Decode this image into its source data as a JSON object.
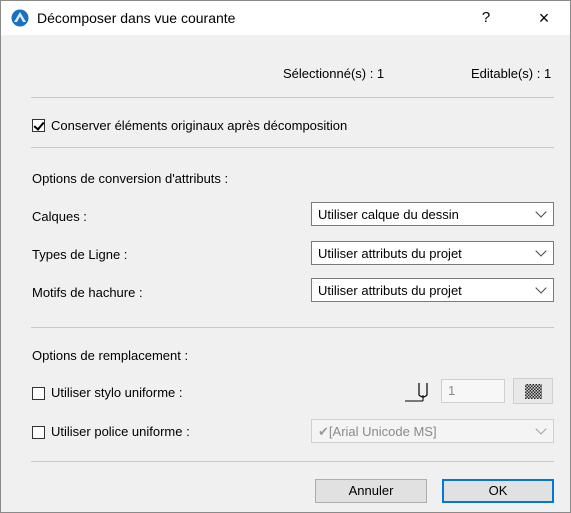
{
  "window": {
    "title": "Décomposer dans vue courante",
    "help": "?",
    "close": "×"
  },
  "status": {
    "selected": "Sélectionné(s) : 1",
    "editable": "Editable(s) : 1"
  },
  "keep_originals": {
    "label": "Conserver éléments originaux après décomposition",
    "checked": true
  },
  "conversion": {
    "heading": "Options de conversion d'attributs :",
    "rows": [
      {
        "label": "Calques :",
        "value": "Utiliser calque du dessin"
      },
      {
        "label": "Types de Ligne :",
        "value": "Utiliser attributs du projet"
      },
      {
        "label": "Motifs de hachure :",
        "value": "Utiliser attributs du projet"
      }
    ]
  },
  "replacement": {
    "heading": "Options de remplacement :",
    "pen": {
      "label": "Utiliser stylo uniforme :",
      "checked": false,
      "value": "1"
    },
    "font": {
      "label": "Utiliser police uniforme :",
      "checked": false,
      "value": "[Arial Unicode MS]"
    }
  },
  "buttons": {
    "cancel": "Annuler",
    "ok": "OK"
  },
  "colors": {
    "accent": "#0078d7",
    "separator": "#c8c8c8",
    "dialog_bg": "#f0f0f0"
  }
}
